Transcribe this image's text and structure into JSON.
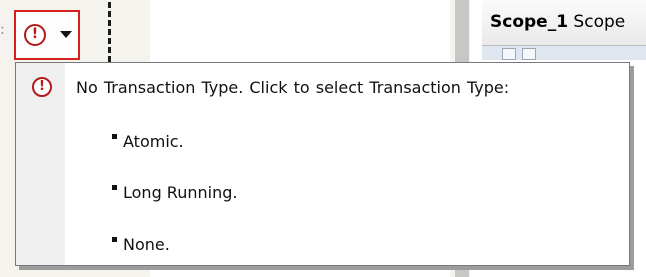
{
  "designer": {
    "background_color": "#f4f3ee",
    "ghost_text": ":"
  },
  "right_panel": {
    "title_bold": "Scope_1",
    "title_rest": " Scope"
  },
  "smart_tag": {
    "icon": "alert-circle-icon",
    "dropdown_icon": "chevron-down-icon",
    "border_color": "#d62020"
  },
  "popup": {
    "icon": "alert-circle-icon",
    "message": "No Transaction Type.  Click to select Transaction Type:",
    "options": [
      {
        "label": "Atomic."
      },
      {
        "label": "Long Running."
      },
      {
        "label": "None."
      }
    ]
  },
  "colors": {
    "alert": "#b31b1b"
  }
}
